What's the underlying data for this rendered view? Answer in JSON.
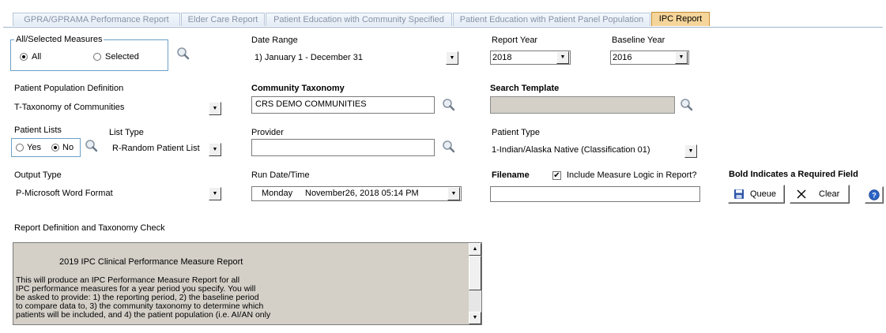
{
  "tabs": [
    {
      "label": "GPRA/GPRAMA Performance Report",
      "active": false
    },
    {
      "label": "Elder Care Report",
      "active": false
    },
    {
      "label": "Patient Education with Community Specified",
      "active": false
    },
    {
      "label": "Patient Education with Patient Panel Population",
      "active": false
    },
    {
      "label": "IPC Report",
      "active": true
    }
  ],
  "measures": {
    "legend": "All/Selected Measures",
    "all_label": "All",
    "selected_label": "Selected",
    "selected": "All"
  },
  "date_range": {
    "label": "Date Range",
    "value": "1) January 1 - December 31"
  },
  "report_year": {
    "label": "Report Year",
    "value": "2018"
  },
  "baseline_year": {
    "label": "Baseline Year",
    "value": "2016"
  },
  "population": {
    "label": "Patient Population Definition",
    "value": "T-Taxonomy of Communities"
  },
  "community": {
    "label": "Community Taxonomy",
    "value": "CRS DEMO COMMUNITIES"
  },
  "search_template": {
    "label": "Search Template",
    "value": ""
  },
  "patient_lists": {
    "label": "Patient Lists",
    "yes_label": "Yes",
    "no_label": "No",
    "selected": "No"
  },
  "list_type": {
    "label": "List Type",
    "value": "R-Random Patient List"
  },
  "provider": {
    "label": "Provider",
    "value": ""
  },
  "patient_type": {
    "label": "Patient Type",
    "value": "1-Indian/Alaska Native (Classification 01)"
  },
  "output_type": {
    "label": "Output Type",
    "value": "P-Microsoft Word Format"
  },
  "run_date": {
    "label": "Run Date/Time",
    "day": "Monday",
    "date": "November26, 2018  05:14 PM"
  },
  "filename": {
    "label": "Filename",
    "value": ""
  },
  "include_logic": {
    "label": "Include Measure Logic in Report?",
    "checked": true
  },
  "required_note": "Bold Indicates a Required Field",
  "buttons": {
    "queue": "Queue",
    "clear": "Clear"
  },
  "definition": {
    "label": "Report Definition and Taxonomy Check",
    "title": "2019 IPC Clinical Performance Measure Report",
    "lines": [
      "This will produce an IPC Performance Measure Report for all",
      "IPC performance measures for a year period you specify.  You will",
      "be asked to provide: 1) the reporting period, 2) the baseline period",
      "to compare data to, 3) the community taxonomy to determine which",
      "patients will be included, and 4) the patient population (i.e. AI/AN only"
    ]
  },
  "colors": {
    "active_tab": "#f6d59a",
    "group_border": "#6aa0c9",
    "disabled_field": "#d4d0c8",
    "help_icon": "#2b63c7"
  }
}
